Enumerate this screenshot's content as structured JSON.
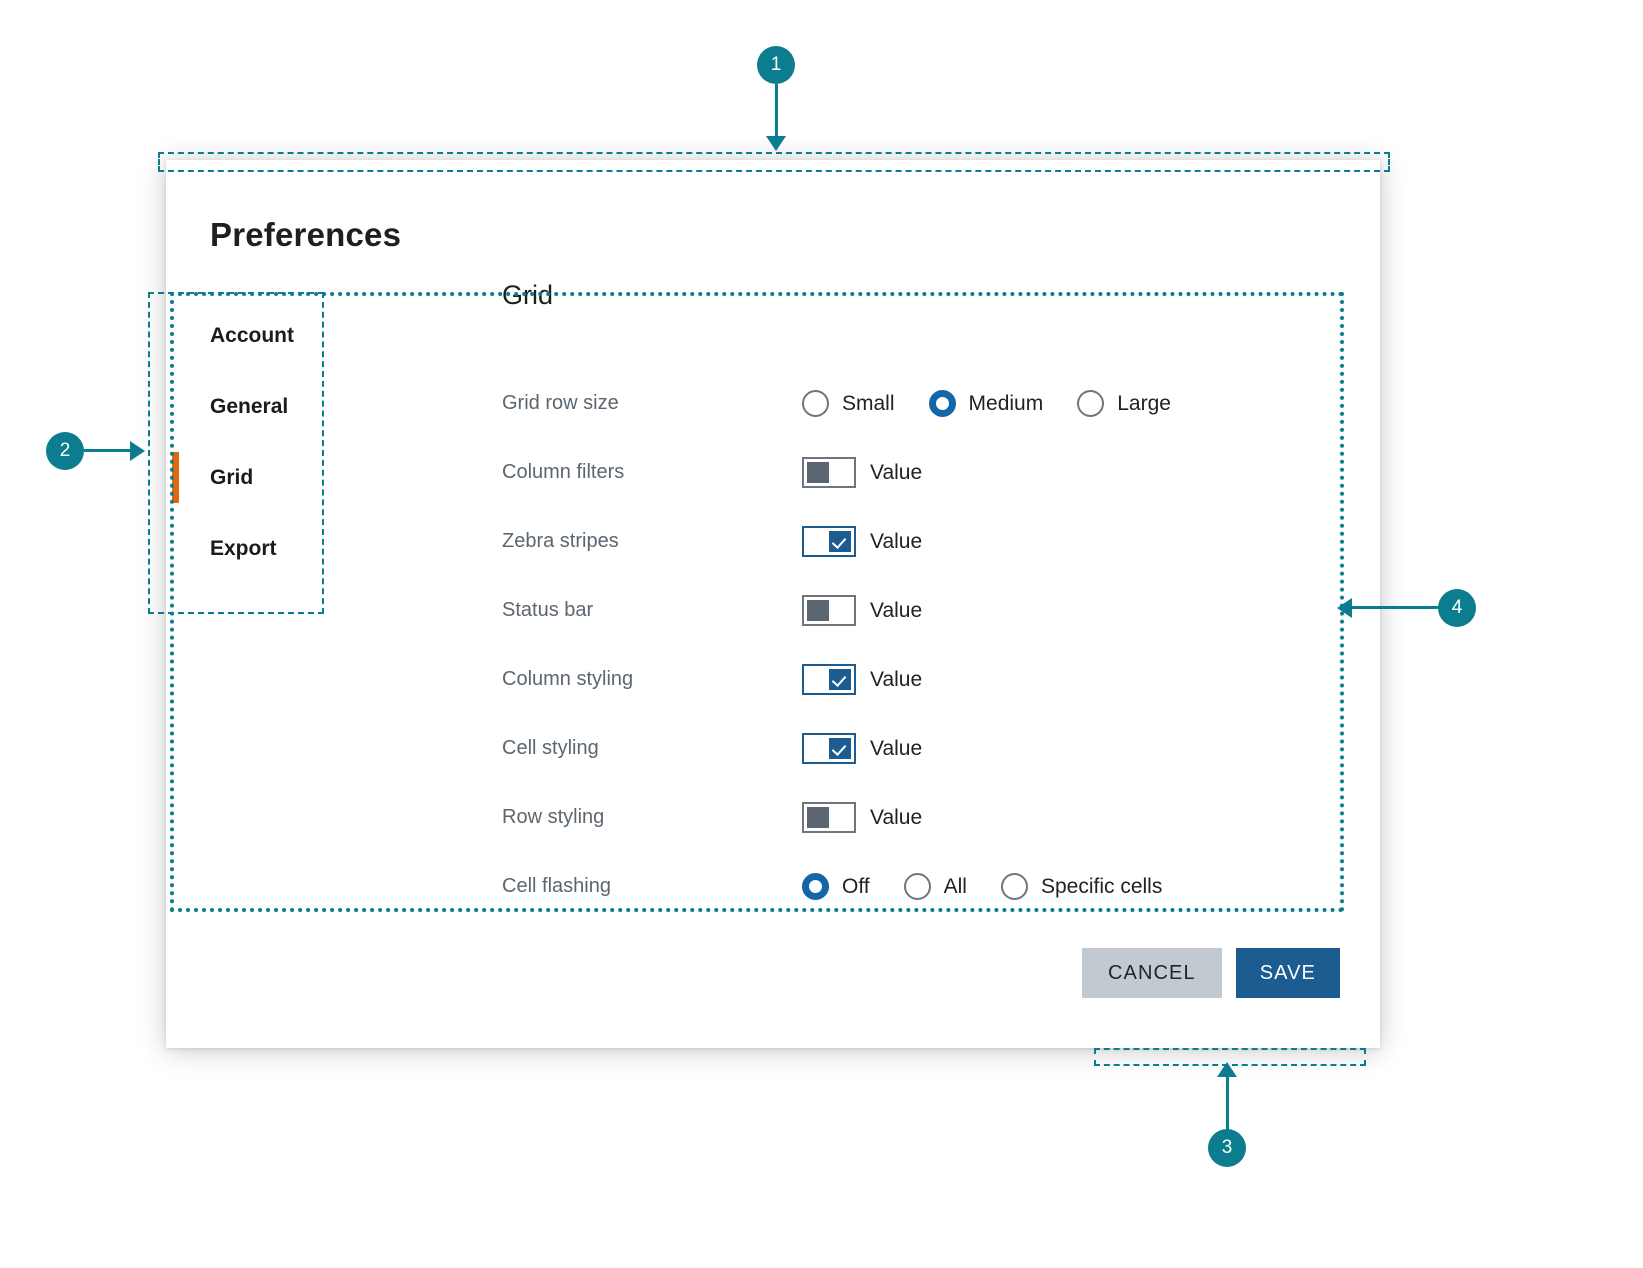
{
  "dialog": {
    "title": "Preferences",
    "sidebar": {
      "items": [
        {
          "label": "Account",
          "active": false
        },
        {
          "label": "General",
          "active": false
        },
        {
          "label": "Grid",
          "active": true
        },
        {
          "label": "Export",
          "active": false
        }
      ]
    },
    "content": {
      "heading": "Grid",
      "rows": [
        {
          "label": "Grid row size",
          "type": "radio",
          "options": [
            {
              "label": "Small",
              "selected": false
            },
            {
              "label": "Medium",
              "selected": true
            },
            {
              "label": "Large",
              "selected": false
            }
          ]
        },
        {
          "label": "Column filters",
          "type": "toggle",
          "value_label": "Value",
          "on": false
        },
        {
          "label": "Zebra stripes",
          "type": "toggle",
          "value_label": "Value",
          "on": true
        },
        {
          "label": "Status bar",
          "type": "toggle",
          "value_label": "Value",
          "on": false
        },
        {
          "label": "Column styling",
          "type": "toggle",
          "value_label": "Value",
          "on": true
        },
        {
          "label": "Cell styling",
          "type": "toggle",
          "value_label": "Value",
          "on": true
        },
        {
          "label": "Row styling",
          "type": "toggle",
          "value_label": "Value",
          "on": false
        },
        {
          "label": "Cell flashing",
          "type": "radio",
          "options": [
            {
              "label": "Off",
              "selected": true
            },
            {
              "label": "All",
              "selected": false
            },
            {
              "label": "Specific cells",
              "selected": false
            }
          ]
        }
      ]
    },
    "footer": {
      "cancel_label": "CANCEL",
      "save_label": "SAVE"
    }
  },
  "callouts": [
    {
      "number": "1"
    },
    {
      "number": "2"
    },
    {
      "number": "3"
    },
    {
      "number": "4"
    }
  ],
  "colors": {
    "accent_teal": "#0b7d8f",
    "active_orange": "#e2650f",
    "primary_blue": "#1d5c91",
    "radio_blue": "#1366a8",
    "cancel_gray": "#c3c9d0",
    "label_gray": "#5c6670"
  }
}
